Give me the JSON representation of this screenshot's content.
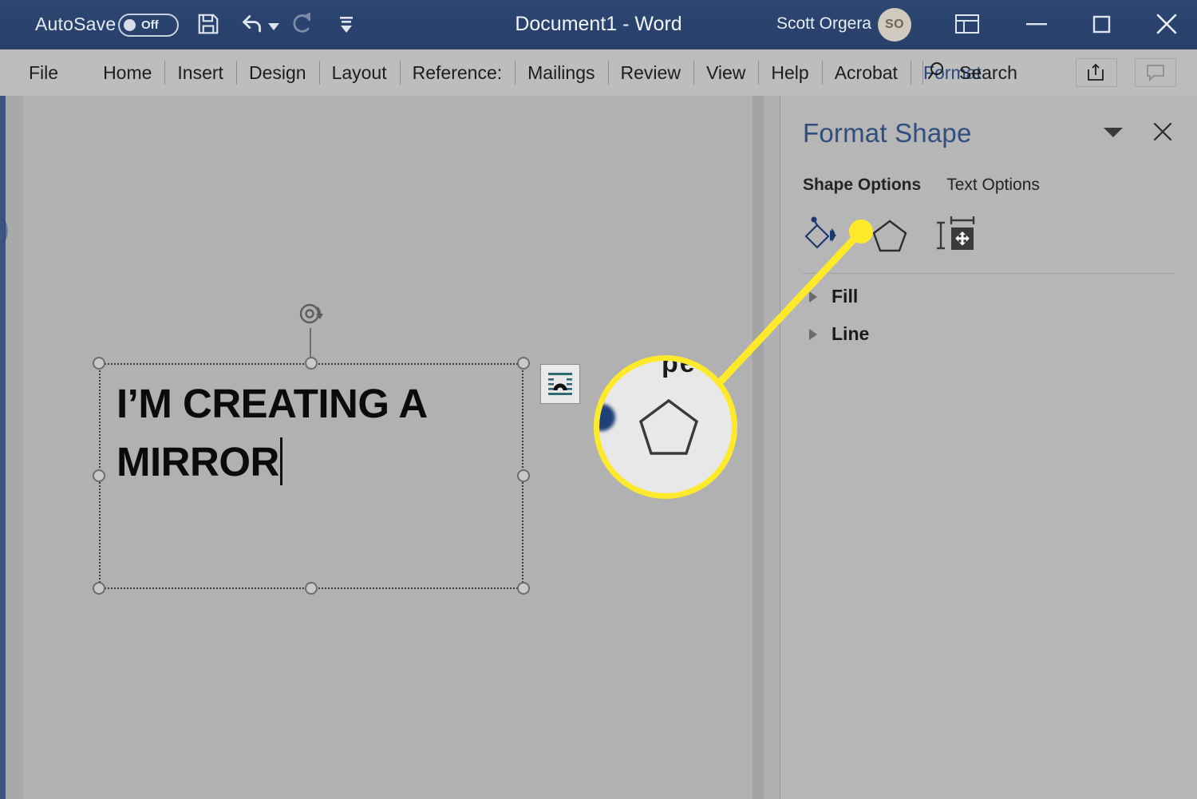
{
  "titlebar": {
    "autosave_label": "AutoSave",
    "autosave_state": "Off",
    "document_title": "Document1  -  Word",
    "user_name": "Scott Orgera",
    "user_initials": "SO",
    "icons": {
      "save": "save-icon",
      "undo": "undo-icon",
      "undo_dropdown": "chevron-down-icon",
      "redo": "redo-icon",
      "customize_qat": "customize-quick-access-toolbar-icon",
      "ribbon_display": "ribbon-display-options-icon",
      "minimize": "minimize-icon",
      "maximize": "maximize-icon",
      "close": "close-icon"
    },
    "accent_color": "#2b4570"
  },
  "ribbon": {
    "tabs": [
      {
        "label": "File"
      },
      {
        "label": "Home"
      },
      {
        "label": "Insert"
      },
      {
        "label": "Design"
      },
      {
        "label": "Layout"
      },
      {
        "label": "Reference:"
      },
      {
        "label": "Mailings"
      },
      {
        "label": "Review"
      },
      {
        "label": "View"
      },
      {
        "label": "Help"
      },
      {
        "label": "Acrobat"
      },
      {
        "label": "Format"
      }
    ],
    "active_tab": "Format",
    "active_tab_color": "#2c4a7c",
    "search_label": "Search",
    "share_icon": "share-icon",
    "comment_icon": "comment-icon",
    "background_color": "#bdbdbd"
  },
  "document": {
    "background_color": "#b1b1b1",
    "textbox": {
      "text": "I’M CREATING A MIRROR",
      "has_caret": true,
      "selected": true,
      "handle_count": 8,
      "rotation_handle": "rotate-icon"
    },
    "layout_options_icon": "layout-options-icon"
  },
  "pane": {
    "title": "Format Shape",
    "collapse_icon": "chevron-down-icon",
    "close_icon": "close-icon",
    "tabs": [
      {
        "label": "Shape Options",
        "active": true
      },
      {
        "label": "Text Options",
        "active": false
      }
    ],
    "category_icons": [
      {
        "name": "fill-and-line-icon",
        "label": "Fill & Line"
      },
      {
        "name": "effects-pentagon-icon",
        "label": "Effects"
      },
      {
        "name": "size-and-properties-icon",
        "label": "Size & Properties"
      }
    ],
    "sections": [
      {
        "label": "Fill",
        "expanded": false
      },
      {
        "label": "Line",
        "expanded": false
      }
    ],
    "title_color": "#314f7e",
    "background_color": "#b6b6b6"
  },
  "callout": {
    "highlight_color": "#ffe92b",
    "target_icon": "effects-pentagon-icon",
    "magnified_crumb_text": "pe"
  }
}
